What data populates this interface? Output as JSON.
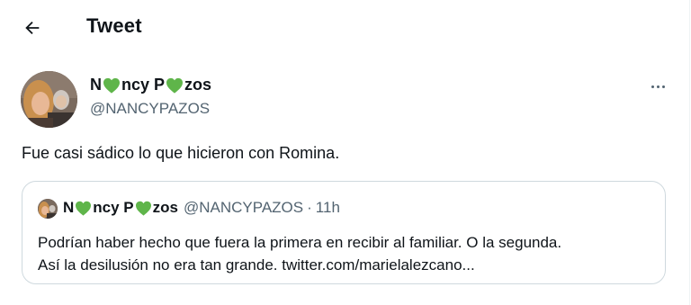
{
  "header": {
    "title": "Tweet",
    "back_icon": "arrow-left-icon"
  },
  "tweet": {
    "name_part1": "N",
    "name_part2": "ncy P",
    "name_part3": "zos",
    "name_emoji": "green-heart-icon",
    "handle": "@NANCYPAZOS",
    "more_icon": "more-horizontal-icon",
    "text": "Fue casi sádico lo que hicieron con Romina."
  },
  "quote": {
    "name_part1": "N",
    "name_part2": "ncy P",
    "name_part3": "zos",
    "handle": "@NANCYPAZOS",
    "separator": "·",
    "time": "11h",
    "line1": "Podrían haber hecho que fuera la primera en recibir al familiar. O la segunda.",
    "line2": "Así la desilusión no era tan grande. twitter.com/marielalezcano..."
  },
  "colors": {
    "heart": "#5fb54a",
    "secondary_text": "#536471",
    "border": "#cfd9de"
  }
}
